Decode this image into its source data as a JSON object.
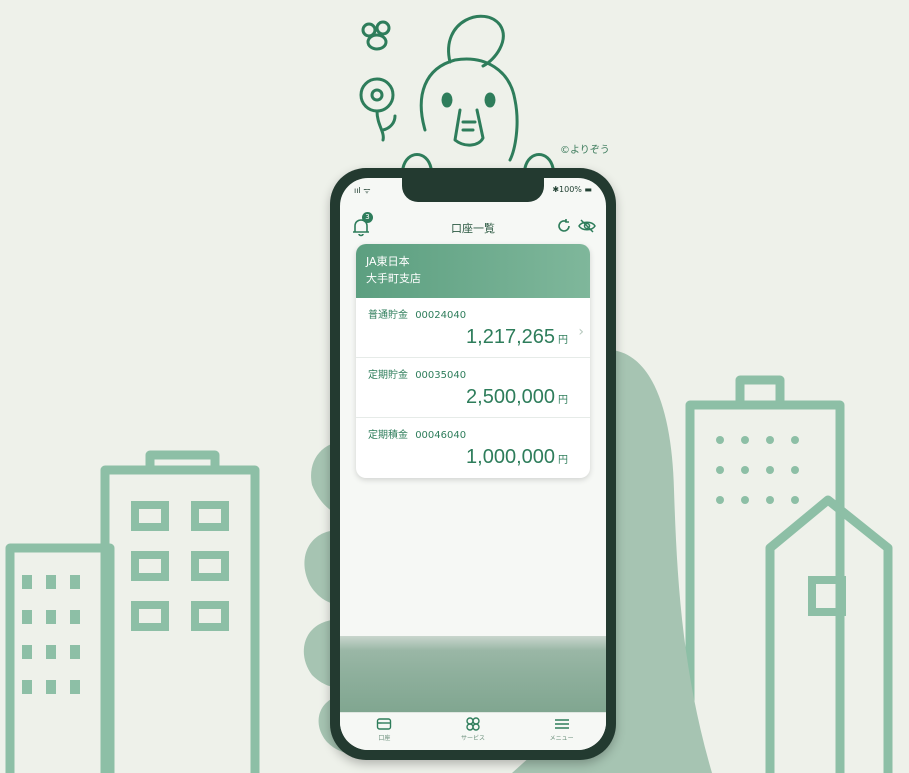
{
  "mascot": {
    "copyright": "©よりぞう"
  },
  "status": {
    "left": "ııl ᯤ",
    "right": "✱100% ▬"
  },
  "nav": {
    "title": "口座一覧",
    "badge": "3"
  },
  "card": {
    "bank": "JA東日本",
    "branch": "大手町支店",
    "accounts": [
      {
        "kind": "普通貯金",
        "number": "00024040",
        "amount": "1,217,265",
        "yen": "円"
      },
      {
        "kind": "定期貯金",
        "number": "00035040",
        "amount": "2,500,000",
        "yen": "円"
      },
      {
        "kind": "定期積金",
        "number": "00046040",
        "amount": "1,000,000",
        "yen": "円"
      }
    ]
  },
  "tabs": [
    {
      "label": "口座"
    },
    {
      "label": "サービス"
    },
    {
      "label": "メニュー"
    }
  ],
  "colors": {
    "brand": "#2e7d5b",
    "bg": "#eef1ea",
    "card_head": "#6aa98a"
  }
}
